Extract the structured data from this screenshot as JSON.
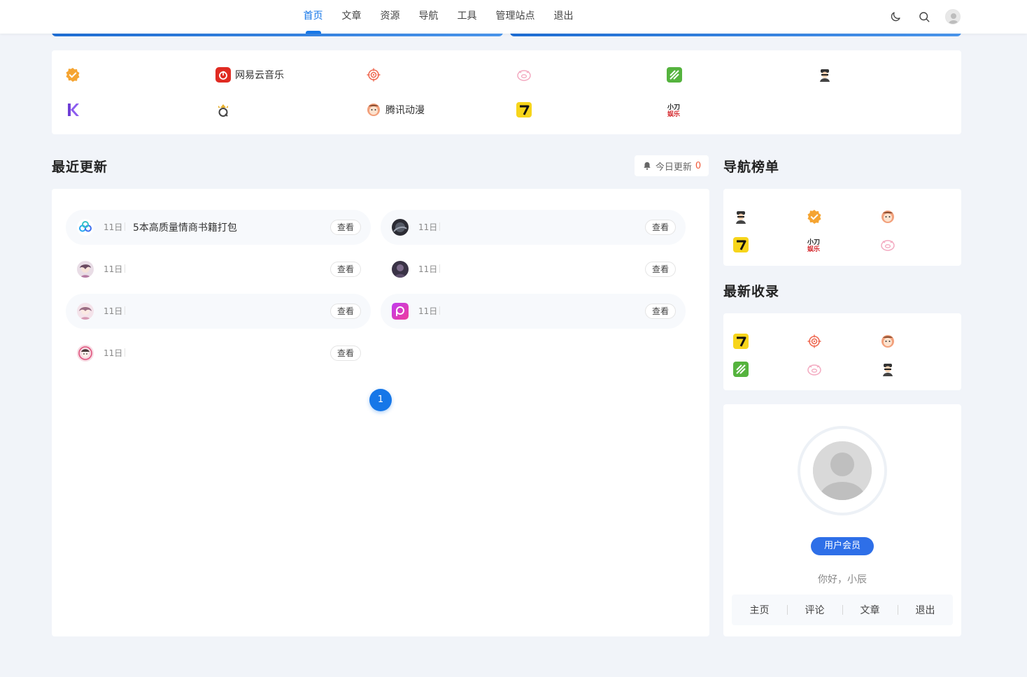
{
  "nav": {
    "items": [
      {
        "label": "首页",
        "active": true
      },
      {
        "label": "文章"
      },
      {
        "label": "资源"
      },
      {
        "label": "导航"
      },
      {
        "label": "工具"
      },
      {
        "label": "管理站点"
      },
      {
        "label": "退出"
      }
    ]
  },
  "links": {
    "netease": "网易云音乐",
    "tencent_comic": "腾讯动漫"
  },
  "recent": {
    "title": "最近更新",
    "today_label": "今日更新",
    "today_count": "0",
    "rows": [
      {
        "date": "11日",
        "title": "5本高质量情商书籍打包",
        "view": "查看"
      },
      {
        "date": "11日",
        "title": "",
        "view": "查看"
      },
      {
        "date": "11日",
        "title": "",
        "view": "查看"
      },
      {
        "date": "11日",
        "title": "",
        "view": "查看"
      },
      {
        "date": "11日",
        "title": "",
        "view": "查看"
      },
      {
        "date": "11日",
        "title": "",
        "view": "查看"
      },
      {
        "date": "11日",
        "title": "",
        "view": "查看"
      }
    ],
    "page": "1"
  },
  "nav_rank": {
    "title": "导航榜单"
  },
  "latest": {
    "title": "最新收录"
  },
  "profile": {
    "member_label": "用户会员",
    "greeting": "你好，小辰",
    "links": [
      "主页",
      "评论",
      "文章",
      "退出"
    ]
  },
  "colors": {
    "accent": "#1677e8",
    "member": "#2e6fe8",
    "count": "#f05a3a"
  }
}
